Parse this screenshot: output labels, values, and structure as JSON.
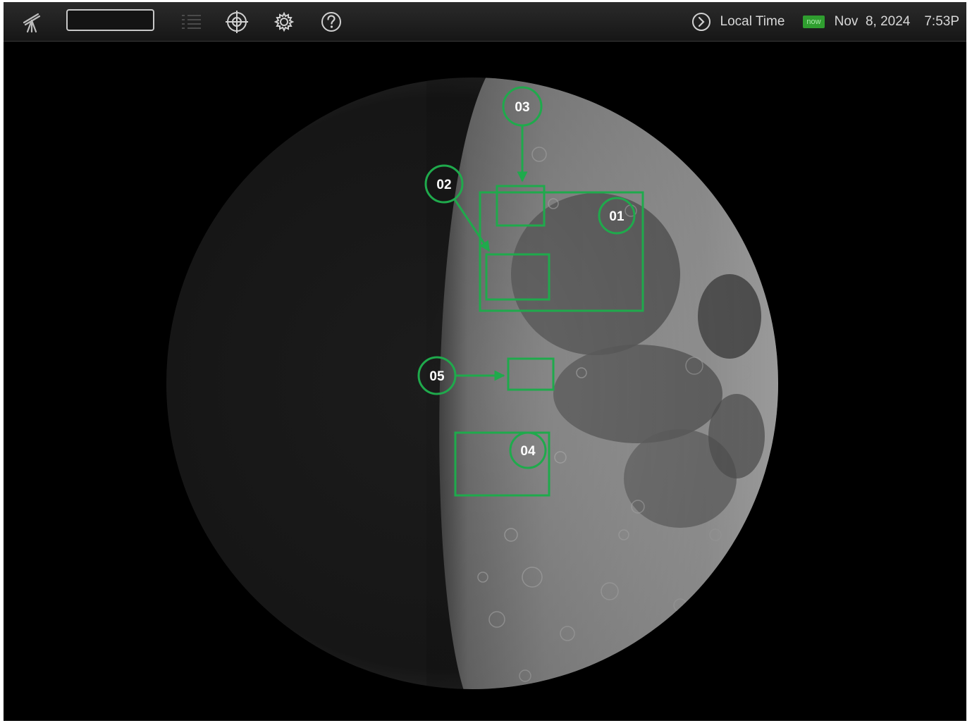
{
  "toolbar": {
    "icons": [
      "telescope-icon",
      "list-icon",
      "crosshair-icon",
      "settings-icon",
      "help-icon"
    ],
    "time_mode_label": "Local Time",
    "now_badge": "now",
    "date": "Nov  8, 2024",
    "time": "7:53P"
  },
  "colors": {
    "annotation": "#1faa4c",
    "toolbar_bg": "#1e1e1e",
    "sky_bg": "#000000",
    "now_badge": "#2f9e2f"
  },
  "annotations": [
    {
      "id": "01"
    },
    {
      "id": "02"
    },
    {
      "id": "03"
    },
    {
      "id": "04"
    },
    {
      "id": "05"
    }
  ]
}
